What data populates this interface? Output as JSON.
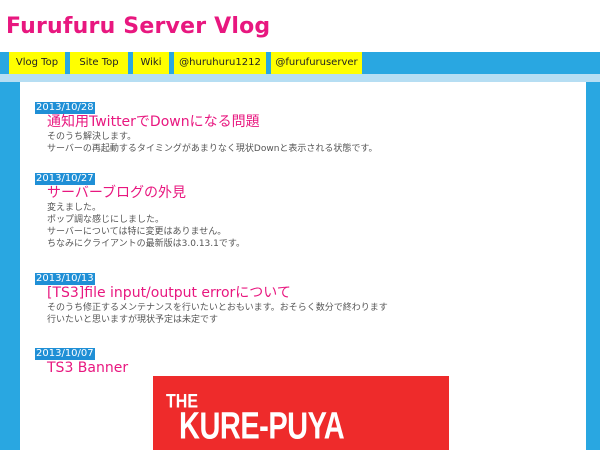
{
  "site": {
    "title": "Furufuru Server Vlog"
  },
  "nav": {
    "items": [
      {
        "label": "Vlog Top"
      },
      {
        "label": "Site Top"
      },
      {
        "label": "Wiki"
      },
      {
        "label": "@huruhuru1212"
      },
      {
        "label": "@furufuruserver"
      }
    ]
  },
  "posts": [
    {
      "date": "2013/10/28",
      "title": "通知用TwitterでDownになる問題",
      "lines": [
        "そのうち解決します。",
        "サーバーの再起動するタイミングがあまりなく現状Downと表示される状態です。"
      ]
    },
    {
      "date": "2013/10/27",
      "title": "サーバーブログの外見",
      "lines": [
        "変えました。",
        "ポップ調な感じにしました。",
        "サーバーについては特に変更はありません。",
        "ちなみにクライアントの最新版は3.0.13.1です。"
      ]
    },
    {
      "date": "2013/10/13",
      "title": "[TS3]file input/output errorについて",
      "lines": [
        "そのうち修正するメンテナンスを行いたいとおもいます。おそらく数分で終わります",
        "行いたいと思いますが現状予定は未定です"
      ]
    },
    {
      "date": "2013/10/07",
      "title": "TS3 Banner",
      "lines": []
    }
  ],
  "banner": {
    "line1": "THE",
    "line2": "KURE-PUYA"
  },
  "colors": {
    "title_pink": "#e8177f",
    "nav_blue": "#29a7e1",
    "nav_button_yellow": "#ffff00",
    "date_blue": "#1f8fd6",
    "banner_red": "#ee2b2b"
  }
}
